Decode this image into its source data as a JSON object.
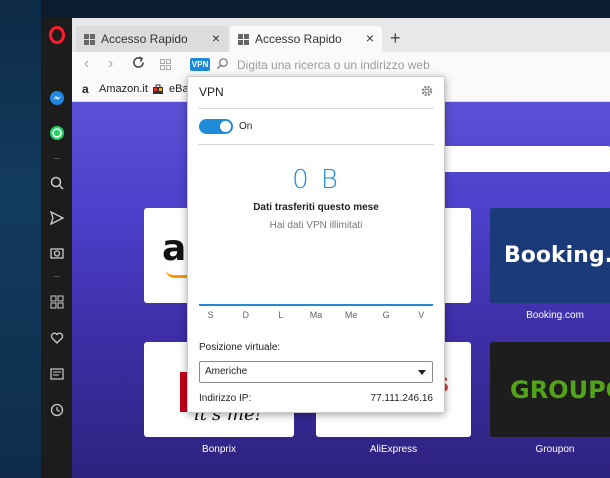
{
  "tabs": [
    {
      "label": "Accesso Rapido"
    },
    {
      "label": "Accesso Rapido"
    }
  ],
  "address_bar": {
    "vpn_badge": "VPN",
    "placeholder": "Digita una ricerca o un indirizzo web"
  },
  "bookmarks": [
    {
      "label": "Amazon.it"
    },
    {
      "label": "eBa"
    }
  ],
  "tiles": [
    {
      "label": "Booking.com",
      "logo_text": "Booking.co"
    },
    {
      "label": "Bonprix"
    },
    {
      "label": "AliExpress"
    },
    {
      "label": "Groupon",
      "logo_text": "GROUPON"
    }
  ],
  "vpn": {
    "title": "VPN",
    "toggle_label": "On",
    "toggle_on": true,
    "bytes": "0 B",
    "data_label": "Dati trasferiti questo mese",
    "data_sub": "Hai dati VPN illimitati",
    "days": [
      "S",
      "D",
      "L",
      "Ma",
      "Me",
      "G",
      "V"
    ],
    "position_label": "Posizione virtuale:",
    "position_value": "Americhe",
    "ip_label": "Indirizzo IP:",
    "ip_value": "77.111.246.16"
  },
  "colors": {
    "accent": "#1d8bd6",
    "opera_red": "#ff1b2d",
    "page_bg": "#4c3fca"
  }
}
